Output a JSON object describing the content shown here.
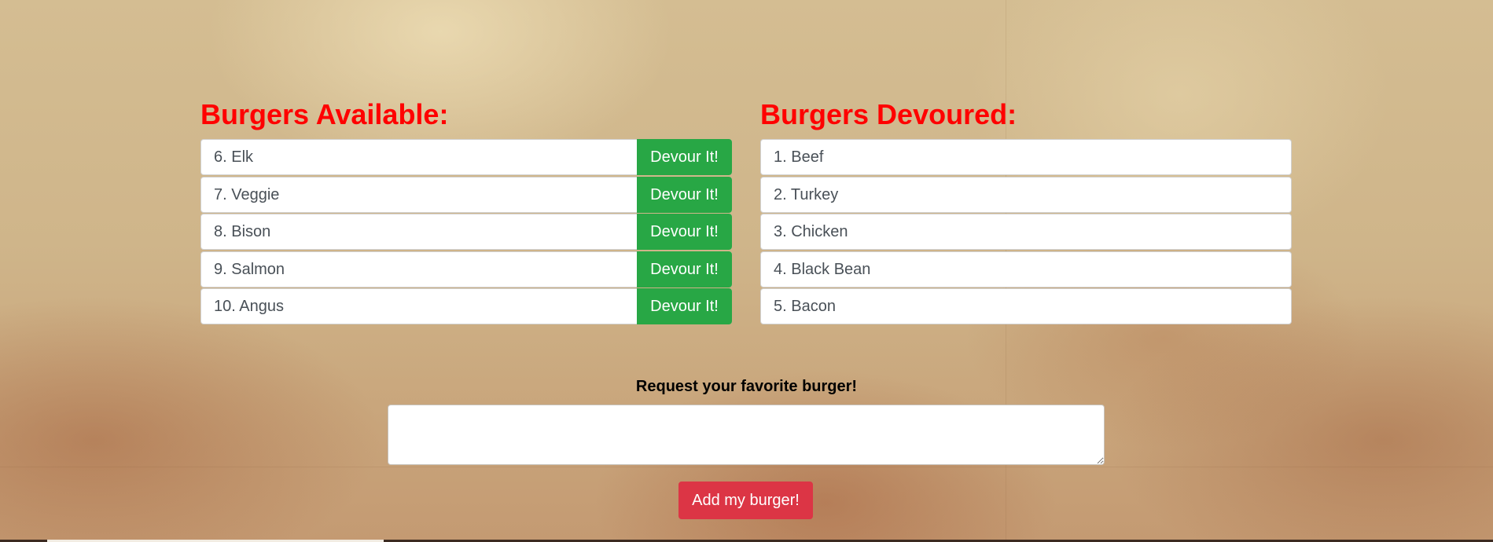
{
  "available": {
    "heading": "Burgers Available:",
    "devour_label": "Devour It!",
    "items": [
      {
        "label": "6. Elk"
      },
      {
        "label": "7. Veggie"
      },
      {
        "label": "8. Bison"
      },
      {
        "label": "9. Salmon"
      },
      {
        "label": "10. Angus"
      }
    ]
  },
  "devoured": {
    "heading": "Burgers Devoured:",
    "items": [
      {
        "label": "1. Beef"
      },
      {
        "label": "2. Turkey"
      },
      {
        "label": "3. Chicken"
      },
      {
        "label": "4. Black Bean"
      },
      {
        "label": "5. Bacon"
      }
    ]
  },
  "form": {
    "label": "Request your favorite burger!",
    "input_value": "",
    "submit_label": "Add my burger!"
  },
  "colors": {
    "heading": "#ff0000",
    "devour_button": "#28a745",
    "add_button": "#dc3545"
  }
}
